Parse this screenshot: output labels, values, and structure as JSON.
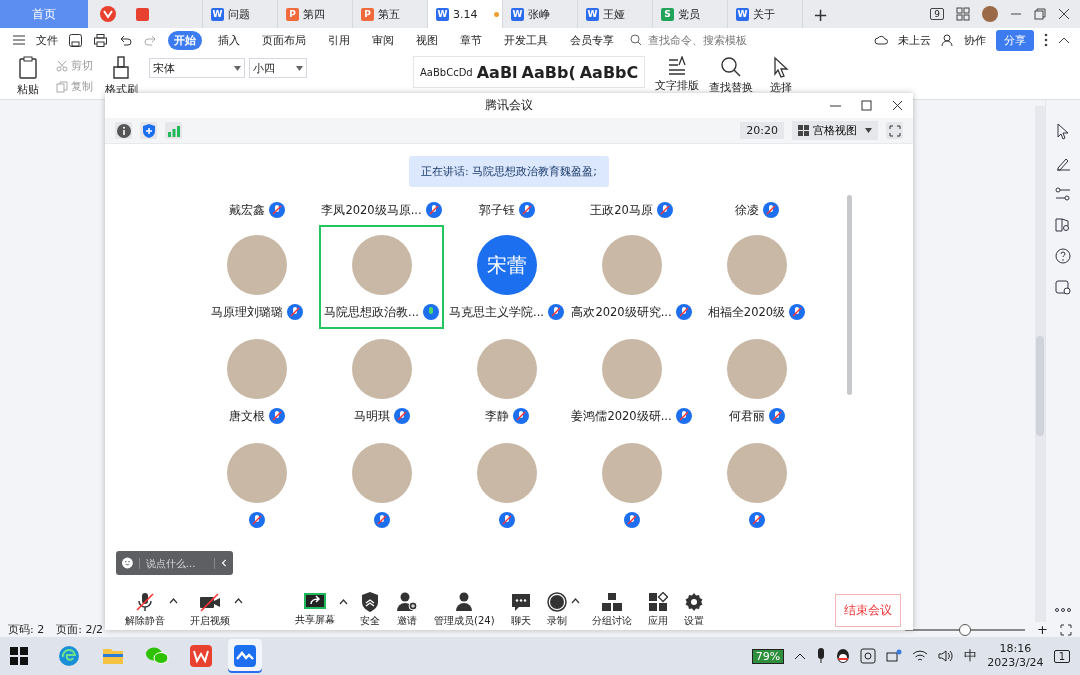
{
  "doc_tabs": {
    "home": "首页",
    "tabs": [
      {
        "color": "#e8412f",
        "selected": false
      },
      {
        "icon": "W",
        "color": "#2b6cf0",
        "label": "问题",
        "selected": false
      },
      {
        "icon": "P",
        "color": "#f06a3b",
        "label": "第四",
        "selected": false
      },
      {
        "icon": "P",
        "color": "#f06a3b",
        "label": "第五",
        "selected": false
      },
      {
        "icon": "W",
        "color": "#2b6cf0",
        "label": "3.14",
        "selected": true,
        "unsaved": true
      },
      {
        "icon": "W",
        "color": "#2b6cf0",
        "label": "张峥",
        "selected": false
      },
      {
        "icon": "W",
        "color": "#2b6cf0",
        "label": "王娅",
        "selected": false
      },
      {
        "icon": "S",
        "color": "#22a35a",
        "label": "党员",
        "selected": false
      },
      {
        "icon": "W",
        "color": "#2b6cf0",
        "label": "关于",
        "selected": false
      }
    ],
    "add": "+",
    "badge": "9"
  },
  "menu": {
    "file": "文件",
    "tabs": [
      {
        "label": "开始",
        "selected": true
      },
      {
        "label": "插入",
        "selected": false
      },
      {
        "label": "页面布局",
        "selected": false
      },
      {
        "label": "引用",
        "selected": false
      },
      {
        "label": "审阅",
        "selected": false
      },
      {
        "label": "视图",
        "selected": false
      },
      {
        "label": "章节",
        "selected": false
      },
      {
        "label": "开发工具",
        "selected": false
      },
      {
        "label": "会员专享",
        "selected": false
      }
    ],
    "search": {
      "placeholder": "查找命令、搜索模板"
    },
    "cloud": "未上云",
    "collab": "协作",
    "share": "分享"
  },
  "ribbon": {
    "paste": "粘贴",
    "cut": "剪切",
    "copy": "复制",
    "format_painter": "格式刷",
    "font": "宋体",
    "size": "小四",
    "styles": [
      "AaBbCcDd",
      "AaBl",
      "AaBb(",
      "AaBbC"
    ],
    "text_layout": "文字排版",
    "find_replace": "查找替换",
    "select": "选择"
  },
  "meeting": {
    "title": "腾讯会议",
    "timer": "20:20",
    "view": "宫格视图",
    "speaking": "正在讲话: 马院思想政治教育魏盈盈;",
    "top_row": [
      {
        "name": "戴宏鑫",
        "muted": true
      },
      {
        "name": "李凤2020级马原...",
        "muted": true
      },
      {
        "name": "郭子钰",
        "muted": true
      },
      {
        "name": "王政20马原",
        "muted": true
      },
      {
        "name": "徐凌",
        "muted": true
      }
    ],
    "tiles": [
      {
        "name": "马原理刘璐璐",
        "muted": true,
        "speaking": false
      },
      {
        "name": "马院思想政治教...",
        "muted": false,
        "speaking": true
      },
      {
        "name": "马克思主义学院...",
        "muted": true,
        "speaking": false,
        "avatar_text": "宋蕾"
      },
      {
        "name": "高欢2020级研究...",
        "muted": true,
        "speaking": false
      },
      {
        "name": "相福全2020级",
        "muted": true,
        "speaking": false
      },
      {
        "name": "唐文根",
        "muted": true,
        "speaking": false
      },
      {
        "name": "马明琪",
        "muted": true,
        "speaking": false
      },
      {
        "name": "李静",
        "muted": true,
        "speaking": false
      },
      {
        "name": "姜鸿儒2020级研...",
        "muted": true,
        "speaking": false
      },
      {
        "name": "何君丽",
        "muted": true,
        "speaking": false
      }
    ],
    "bottom_row": [
      {
        "muted": true
      },
      {
        "muted": true
      },
      {
        "muted": true
      },
      {
        "muted": true
      },
      {
        "muted": true
      }
    ],
    "chat_placeholder": "说点什么...",
    "toolbar": [
      {
        "label": "解除静音",
        "off": true,
        "menu": true
      },
      {
        "label": "开启视频",
        "off": true,
        "menu": true
      },
      {
        "label": "共享屏幕",
        "menu": true
      },
      {
        "label": "安全"
      },
      {
        "label": "邀请"
      },
      {
        "label": "管理成员(24)"
      },
      {
        "label": "聊天"
      },
      {
        "label": "录制",
        "menu": true
      },
      {
        "label": "分组讨论"
      },
      {
        "label": "应用"
      },
      {
        "label": "设置"
      }
    ],
    "end": "结束会议"
  },
  "status_bar": {
    "page_no": "页码: 2",
    "pages": "页面: 2/2",
    "zoom": {
      "level": 0.5
    },
    "zoom_in": "+"
  },
  "taskbar": {
    "apps": [
      {
        "active": false
      },
      {
        "active": false
      },
      {
        "active": false
      },
      {
        "active": false
      },
      {
        "active": true
      }
    ],
    "battery": "79%",
    "ime": "中",
    "time": "18:16",
    "date": "2023/3/24",
    "notifications": "1"
  }
}
